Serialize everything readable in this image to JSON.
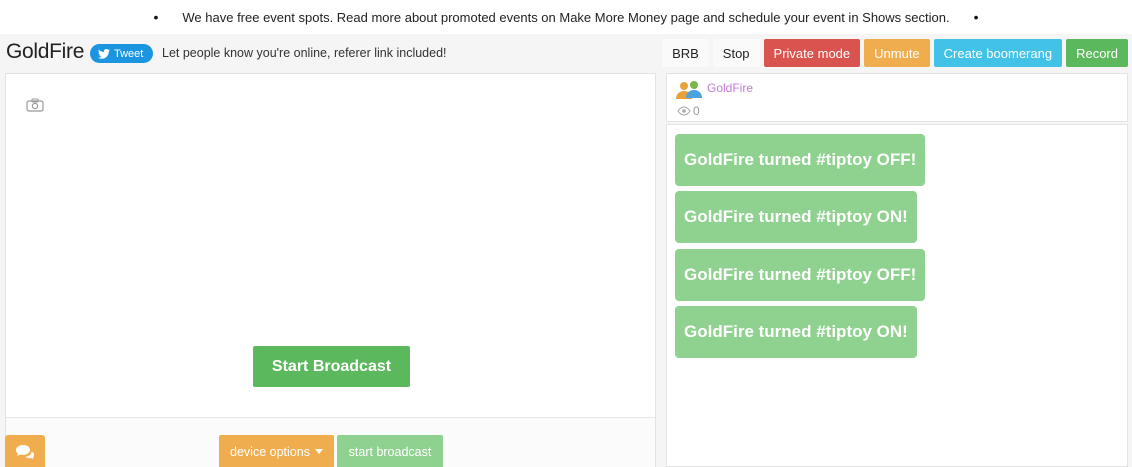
{
  "notice": {
    "text": "We have free event spots. Read more about promoted events on Make More Money page and schedule your event in Shows section.",
    "bullet": "•"
  },
  "header": {
    "brand": "GoldFire",
    "tweet_label": "Tweet",
    "share_text": "Let people know you're online, referer link included!"
  },
  "toolbar": {
    "brb": "BRB",
    "stop": "Stop",
    "private_mode": "Private mode",
    "unmute": "Unmute",
    "create_boomerang": "Create boomerang",
    "record": "Record"
  },
  "broadcast": {
    "start_label": "Start Broadcast",
    "device_options": "device options",
    "start_small": "start broadcast"
  },
  "user": {
    "name": "GoldFire",
    "viewers": "0"
  },
  "chat": {
    "messages": [
      "GoldFire turned #tiptoy OFF!",
      "GoldFire turned #tiptoy ON!",
      "GoldFire turned #tiptoy OFF!",
      "GoldFire turned #tiptoy ON!"
    ]
  },
  "colors": {
    "green": "#5cb85c",
    "light_green": "#8fd18f",
    "red": "#d9534f",
    "orange": "#f0ad4e",
    "blue": "#43c2e8",
    "twitter": "#1b95e0"
  },
  "icons": [
    "camera-icon",
    "twitter-bird-icon",
    "users-icon",
    "eye-icon",
    "chat-icon",
    "caret-down-icon"
  ]
}
